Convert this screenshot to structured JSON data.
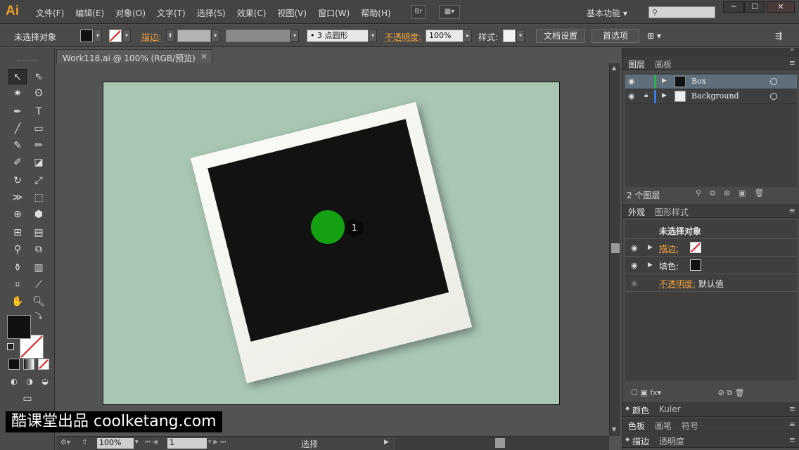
{
  "app": {
    "logo": "Ai",
    "menus": [
      "文件(F)",
      "编辑(E)",
      "对象(O)",
      "文字(T)",
      "选择(S)",
      "效果(C)",
      "视图(V)",
      "窗口(W)",
      "帮助(H)"
    ],
    "bridge_label": "Br",
    "workspace": "基本功能",
    "accent_color": "#e89b2c"
  },
  "control_bar": {
    "selection": "未选择对象",
    "stroke_label": "描边:",
    "stroke_weight_value": "",
    "brush_label": "3 点圆形",
    "opacity_label": "不透明度:",
    "opacity_value": "100%",
    "style_label": "样式:",
    "doc_setup_button": "文档设置",
    "preferences_button": "首选项"
  },
  "document": {
    "tab_title": "Work118.ai @ 100% (RGB/预览)",
    "artboard_color": "#a9c6b3",
    "marker_label": "1"
  },
  "status_bar": {
    "zoom": "100%",
    "page": "1",
    "state": "选择"
  },
  "panels": {
    "layers_tabs": [
      "图层",
      "画板"
    ],
    "layers": [
      {
        "name": "Box",
        "color": "#2fb04a",
        "selected": true
      },
      {
        "name": "Background",
        "color": "#3d7be0",
        "selected": false
      }
    ],
    "layers_count": "2 个图层",
    "appearance_tabs": [
      "外观",
      "图形样式"
    ],
    "appearance": {
      "title": "未选择对象",
      "stroke_label": "描边:",
      "fill_label": "填色:",
      "opacity_label": "不透明度:",
      "opacity_value": "默认值"
    },
    "collapsed_groups": [
      [
        "颜色",
        "Kuler"
      ],
      [
        "色板",
        "画笔",
        "符号"
      ],
      [
        "描边",
        "透明度"
      ]
    ]
  },
  "watermark": "酷课堂出品 coolketang.com"
}
